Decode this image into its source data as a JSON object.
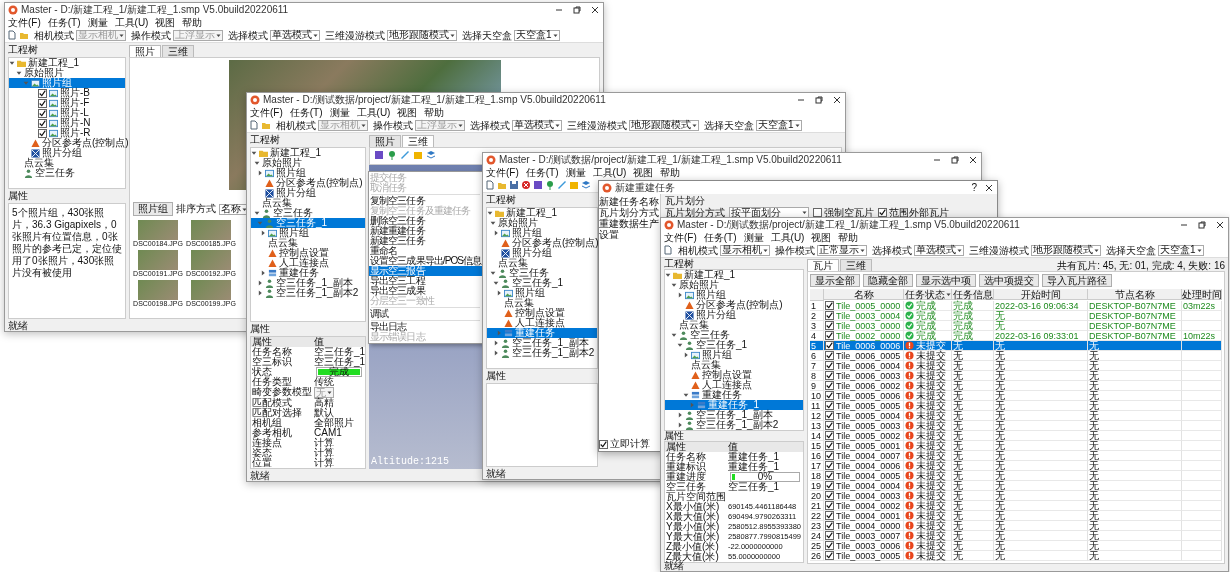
{
  "window_1": {
    "title": "Master - D:/新建工程_1/新建工程_1.smp V5.0build20220611",
    "menu": [
      "文件(F)",
      "任务(T)",
      "测量",
      "工具(U)",
      "视图",
      "帮助"
    ],
    "modes": [
      {
        "label": "相机模式",
        "value": "显示相机",
        "disabled": true
      },
      {
        "label": "操作模式",
        "value": "上浮显示",
        "disabled": true
      },
      {
        "label": "选择模式",
        "value": "单选模式",
        "disabled": false
      },
      {
        "label": "三维漫游模式",
        "value": "地形跟随模式",
        "disabled": false
      },
      {
        "label": "选择天空盒",
        "value": "天空盒1",
        "disabled": false
      }
    ],
    "tree_title": "工程树",
    "tree": [
      {
        "label": "新建工程_1",
        "kind": "folder",
        "selected": false,
        "expanded": true,
        "children": [
          {
            "label": "原始照片",
            "kind": "text",
            "selected": false,
            "expanded": true,
            "children": [
              {
                "label": "照片组",
                "kind": "image",
                "selected": true,
                "expanded": true,
                "children": [
                  {
                    "label": "照片-B",
                    "kind": "image",
                    "selected": false,
                    "checked": true
                  },
                  {
                    "label": "照片-F",
                    "kind": "image",
                    "selected": false,
                    "checked": true
                  },
                  {
                    "label": "照片-L",
                    "kind": "image",
                    "selected": false,
                    "checked": true
                  },
                  {
                    "label": "照片-N",
                    "kind": "image",
                    "selected": false,
                    "checked": true
                  },
                  {
                    "label": "照片-R",
                    "kind": "image",
                    "selected": false,
                    "checked": true
                  }
                ]
              },
              {
                "label": "分区参考点(控制点)",
                "kind": "triangle",
                "selected": false
              },
              {
                "label": "照片分组",
                "kind": "grid",
                "selected": false
              }
            ]
          },
          {
            "label": "点云集",
            "kind": "text",
            "selected": false
          },
          {
            "label": "空三任务",
            "kind": "person",
            "selected": false
          }
        ]
      }
    ],
    "props_title": "属性",
    "summary": "5个照片组，430张照片，36.3 Gigapixels，0张照片有位置信息，0张照片的参考已定，定位使用了0张照片，430张照片没有被使用",
    "tabs": [
      {
        "label": "照片",
        "selected": true
      },
      {
        "label": "三维",
        "selected": false
      }
    ],
    "group_button": "照片组",
    "sort_label": "排序方式",
    "sort_value": "名称",
    "thumbnails": [
      "DSC00184.JPG",
      "DSC00185.JPG",
      "DSC00191.JPG",
      "DSC00192.JPG",
      "DSC00198.JPG",
      "DSC00199.JPG"
    ],
    "status": "就绪"
  },
  "window_2": {
    "title": "Master - D:/测试数据/project/新建工程_1/新建工程_1.smp V5.0build20220611",
    "menu": [
      "文件(F)",
      "任务(T)",
      "测量",
      "工具(U)",
      "视图",
      "帮助"
    ],
    "modes": [
      {
        "label": "相机模式",
        "value": "显示相机",
        "disabled": true
      },
      {
        "label": "操作模式",
        "value": "上浮显示",
        "disabled": true
      },
      {
        "label": "选择模式",
        "value": "单选模式",
        "disabled": false
      },
      {
        "label": "三维漫游模式",
        "value": "地形跟随模式",
        "disabled": false
      },
      {
        "label": "选择天空盒",
        "value": "天空盒1",
        "disabled": false
      }
    ],
    "tree_title": "工程树",
    "tree": [
      {
        "label": "新建工程_1",
        "kind": "folder",
        "selected": false,
        "expanded": true,
        "children": [
          {
            "label": "原始照片",
            "kind": "text",
            "selected": false,
            "expanded": true,
            "children": [
              {
                "label": "照片组",
                "kind": "image",
                "selected": false,
                "expanded": false
              },
              {
                "label": "分区参考点(控制点)",
                "kind": "triangle",
                "selected": false
              },
              {
                "label": "照片分组",
                "kind": "grid",
                "selected": false
              }
            ]
          },
          {
            "label": "点云集",
            "kind": "text",
            "selected": false
          },
          {
            "label": "空三任务",
            "kind": "person",
            "selected": false,
            "expanded": true,
            "children": [
              {
                "label": "空三任务_1",
                "kind": "person",
                "selected": true,
                "expanded": true,
                "children": [
                  {
                    "label": "照片组",
                    "kind": "image",
                    "selected": false,
                    "expanded": false
                  },
                  {
                    "label": "点云集",
                    "kind": "text",
                    "selected": false
                  },
                  {
                    "label": "控制点设置",
                    "kind": "triangle",
                    "selected": false
                  },
                  {
                    "label": "人工连接点",
                    "kind": "triangle",
                    "selected": false
                  },
                  {
                    "label": "重建任务",
                    "kind": "stack",
                    "selected": false,
                    "expanded": false
                  }
                ]
              },
              {
                "label": "空三任务_1_副本",
                "kind": "person",
                "selected": false,
                "expanded": false
              },
              {
                "label": "空三任务_1_副本2",
                "kind": "person",
                "selected": false,
                "expanded": false
              }
            ]
          }
        ]
      }
    ],
    "context_menu": [
      {
        "kind": "item",
        "label": "提交任务",
        "disabled": true,
        "selected": false
      },
      {
        "kind": "item",
        "label": "取消任务",
        "disabled": true,
        "selected": false
      },
      {
        "kind": "separator"
      },
      {
        "kind": "item",
        "label": "复制空三任务",
        "disabled": false,
        "selected": false
      },
      {
        "kind": "item",
        "label": "复制空三任务及重建任务",
        "disabled": true,
        "selected": false
      },
      {
        "kind": "item",
        "label": "删除空三任务",
        "disabled": false,
        "selected": false
      },
      {
        "kind": "item",
        "label": "新建重建任务",
        "disabled": false,
        "selected": false
      },
      {
        "kind": "item",
        "label": "新建空三任务",
        "disabled": false,
        "selected": false
      },
      {
        "kind": "item",
        "label": "重命名",
        "disabled": false,
        "selected": false
      },
      {
        "kind": "item",
        "label": "设置空三成果导出/POS信息",
        "disabled": false,
        "selected": false
      },
      {
        "kind": "item",
        "label": "显示空三报告",
        "disabled": false,
        "selected": true
      },
      {
        "kind": "item",
        "label": "导出空三工程",
        "disabled": false,
        "selected": false
      },
      {
        "kind": "item",
        "label": "导出空三成果",
        "disabled": false,
        "selected": false
      },
      {
        "kind": "item",
        "label": "分层空三一致性",
        "disabled": true,
        "selected": false
      },
      {
        "kind": "separator"
      },
      {
        "kind": "item",
        "label": "调试",
        "disabled": false,
        "selected": false
      },
      {
        "kind": "separator"
      },
      {
        "kind": "item",
        "label": "导出日志",
        "disabled": false,
        "selected": false
      },
      {
        "kind": "item",
        "label": "显示错误日志",
        "disabled": true,
        "selected": false
      }
    ],
    "props_title": "属性",
    "props_header": [
      "属性",
      "值"
    ],
    "props": [
      {
        "kind": "text",
        "name": "任务名称",
        "value": "空三任务_1"
      },
      {
        "kind": "text",
        "name": "空三标识",
        "value": "空三任务_1"
      },
      {
        "kind": "progress",
        "name": "状态",
        "value": "完成",
        "level": 1
      },
      {
        "kind": "text",
        "name": "任务类型",
        "value": "传统"
      },
      {
        "kind": "dropdown",
        "name": "畸变参数模型",
        "value": "无"
      },
      {
        "kind": "text",
        "name": "匹配模式",
        "value": "高精"
      },
      {
        "kind": "text",
        "name": "匹配对选择",
        "value": "默认"
      },
      {
        "kind": "text",
        "name": "相机组",
        "value": "全部照片"
      },
      {
        "kind": "text",
        "name": "参考相机",
        "value": "CAM1"
      },
      {
        "kind": "text",
        "name": "连接点",
        "value": "计算"
      },
      {
        "kind": "text",
        "name": "姿态",
        "value": "计算"
      },
      {
        "kind": "text",
        "name": "位置",
        "value": "计算"
      }
    ],
    "tabs": [
      {
        "label": "照片",
        "selected": false
      },
      {
        "label": "三维",
        "selected": true
      }
    ],
    "altitude": "Altitude:1215",
    "status": "就绪"
  },
  "window_3": {
    "title": "Master - D:/测试数据/project/新建工程_1/新建工程_1.smp V5.0build20220611",
    "menu": [
      "文件(F)",
      "任务(T)",
      "测量",
      "工具(U)",
      "视图",
      "帮助"
    ],
    "tree_title": "工程树",
    "tree": [
      {
        "label": "新建工程_1",
        "kind": "folder",
        "selected": false,
        "expanded": true,
        "children": [
          {
            "label": "原始照片",
            "kind": "text",
            "selected": false,
            "expanded": true,
            "children": [
              {
                "label": "照片组",
                "kind": "image",
                "selected": false,
                "expanded": false
              },
              {
                "label": "分区参考点(控制点)",
                "kind": "triangle",
                "selected": false
              },
              {
                "label": "照片分组",
                "kind": "grid",
                "selected": false
              }
            ]
          },
          {
            "label": "点云集",
            "kind": "text",
            "selected": false
          },
          {
            "label": "空三任务",
            "kind": "person",
            "selected": false,
            "expanded": true,
            "children": [
              {
                "label": "空三任务_1",
                "kind": "person",
                "selected": false,
                "expanded": true,
                "children": [
                  {
                    "label": "照片组",
                    "kind": "image",
                    "selected": false,
                    "expanded": false
                  },
                  {
                    "label": "点云集",
                    "kind": "text",
                    "selected": false
                  },
                  {
                    "label": "控制点设置",
                    "kind": "triangle",
                    "selected": false
                  },
                  {
                    "label": "人工连接点",
                    "kind": "triangle",
                    "selected": false
                  },
                  {
                    "label": "重建任务",
                    "kind": "stack",
                    "selected": true,
                    "expanded": false
                  }
                ]
              },
              {
                "label": "空三任务_1_副本",
                "kind": "person",
                "selected": false,
                "expanded": false
              },
              {
                "label": "空三任务_1_副本2",
                "kind": "person",
                "selected": false,
                "expanded": false
              }
            ]
          }
        ]
      }
    ],
    "props_title": "属性",
    "status": "就绪"
  },
  "dialog": {
    "title": "新建重建任务",
    "help": "?",
    "nav": [
      {
        "label": "新建任务名称",
        "selected": false
      },
      {
        "label": "瓦片划分方式",
        "selected": false
      },
      {
        "label": "重建数据生产",
        "selected": false
      },
      {
        "label": "设置",
        "selected": false
      }
    ],
    "section": "瓦片划分",
    "field_label": "瓦片划分方式",
    "field_value": "按平面划分",
    "options": [
      {
        "label": "强制空瓦片",
        "checked": false
      },
      {
        "label": "范围外部瓦片",
        "checked": true
      }
    ],
    "submit_now": {
      "label": "立即计算",
      "checked": true
    }
  },
  "window_4": {
    "title": "Master - D:/测试数据/project/新建工程_1/新建工程_1.smp V5.0build20220611",
    "menu": [
      "文件(F)",
      "任务(T)",
      "测量",
      "工具(U)",
      "视图",
      "帮助"
    ],
    "modes": [
      {
        "label": "相机模式",
        "value": "显示相机",
        "disabled": false
      },
      {
        "label": "操作模式",
        "value": "正常显示",
        "disabled": false
      },
      {
        "label": "选择模式",
        "value": "单选模式",
        "disabled": false
      },
      {
        "label": "三维漫游模式",
        "value": "地形跟随模式",
        "disabled": false
      },
      {
        "label": "选择天空盒",
        "value": "天空盒1",
        "disabled": false
      }
    ],
    "tree_title": "工程树",
    "tree": [
      {
        "label": "新建工程_1",
        "kind": "folder",
        "selected": false,
        "expanded": true,
        "children": [
          {
            "label": "原始照片",
            "kind": "text",
            "selected": false,
            "expanded": true,
            "children": [
              {
                "label": "照片组",
                "kind": "image",
                "selected": false,
                "expanded": false
              },
              {
                "label": "分区参考点(控制点)",
                "kind": "triangle",
                "selected": false
              },
              {
                "label": "照片分组",
                "kind": "grid",
                "selected": false
              }
            ]
          },
          {
            "label": "点云集",
            "kind": "text",
            "selected": false
          },
          {
            "label": "空三任务",
            "kind": "person",
            "selected": false,
            "expanded": true,
            "children": [
              {
                "label": "空三任务_1",
                "kind": "person",
                "selected": false,
                "expanded": true,
                "children": [
                  {
                    "label": "照片组",
                    "kind": "image",
                    "selected": false,
                    "expanded": false
                  },
                  {
                    "label": "点云集",
                    "kind": "text",
                    "selected": false
                  },
                  {
                    "label": "控制点设置",
                    "kind": "triangle",
                    "selected": false
                  },
                  {
                    "label": "人工连接点",
                    "kind": "triangle",
                    "selected": false
                  },
                  {
                    "label": "重建任务",
                    "kind": "stack",
                    "selected": false,
                    "expanded": true,
                    "children": [
                      {
                        "label": "重建任务_1",
                        "kind": "stack",
                        "selected": true,
                        "expanded": false
                      }
                    ]
                  }
                ]
              },
              {
                "label": "空三任务_1_副本",
                "kind": "person",
                "selected": false,
                "expanded": false
              },
              {
                "label": "空三任务_1_副本2",
                "kind": "person",
                "selected": false,
                "expanded": false
              }
            ]
          }
        ]
      }
    ],
    "props_title": "属性",
    "props_header": [
      "属性",
      "值"
    ],
    "props": [
      {
        "kind": "text",
        "name": "任务名称",
        "value": "重建任务_1"
      },
      {
        "kind": "text",
        "name": "重建标识",
        "value": "重建任务_1"
      },
      {
        "kind": "progress",
        "name": "重建进度",
        "value": "0%",
        "level": 0.05
      },
      {
        "kind": "text",
        "name": "空三任务",
        "value": "空三任务_1"
      },
      {
        "kind": "text",
        "name": "瓦片空间范围"
      },
      {
        "kind": "text",
        "name": "X最小值(米)",
        "value": "690145.4461186448"
      },
      {
        "kind": "text",
        "name": "X最大值(米)",
        "value": "690494.9790263311"
      },
      {
        "kind": "text",
        "name": "Y最小值(米)",
        "value": "2580512.8955393380"
      },
      {
        "kind": "text",
        "name": "Y最大值(米)",
        "value": "2580877.7990815499"
      },
      {
        "kind": "text",
        "name": "Z最小值(米)",
        "value": "-22.0000000000"
      },
      {
        "kind": "text",
        "name": "Z最大值(米)",
        "value": "55.0000000000"
      }
    ],
    "tabs": [
      {
        "label": "瓦片",
        "selected": true
      },
      {
        "label": "三维",
        "selected": false
      }
    ],
    "summary": "共有瓦片: 45, 无: 01, 完成: 4, 失败: 16",
    "buttons": [
      "显示全部",
      "隐藏全部",
      "显示选中项",
      "选中项提交",
      "导入瓦片路径"
    ],
    "columns": [
      {
        "label": "名称",
        "sorted": false
      },
      {
        "label": "任务状态",
        "sorted": true
      },
      {
        "label": "任务信息",
        "sorted": false
      },
      {
        "label": "开始时间",
        "sorted": false
      },
      {
        "label": "节点名称",
        "sorted": false
      },
      {
        "label": "处理时间",
        "sorted": false
      }
    ],
    "rows": [
      {
        "index": "1",
        "checked": true,
        "name": "Tile_0005_0000",
        "kind": "done",
        "status": "完成",
        "info": "完成",
        "start": "2022-03-16 09:06:34",
        "node": "DESKTOP-B07N7ME",
        "duration": "03m22s",
        "selected": false
      },
      {
        "index": "2",
        "checked": true,
        "name": "Tile_0003_0004",
        "kind": "done",
        "status": "完成",
        "info": "完成",
        "start": "无",
        "node": "DESKTOP-B07N7ME",
        "selected": false
      },
      {
        "index": "3",
        "checked": true,
        "name": "Tile_0003_0000",
        "kind": "done",
        "status": "完成",
        "info": "完成",
        "start": "无",
        "node": "DESKTOP-B07N7ME",
        "selected": false
      },
      {
        "index": "4",
        "checked": true,
        "name": "Tile_0002_0000",
        "kind": "done",
        "status": "完成",
        "info": "完成",
        "start": "2022-03-16 09:33:01",
        "node": "DESKTOP-B07N7ME",
        "duration": "10m22s",
        "selected": false
      },
      {
        "index": "5",
        "checked": true,
        "name": "Tile_0006_0006",
        "kind": "pending",
        "status": "未提交",
        "info": "无",
        "start": "无",
        "node": "无",
        "selected": true
      },
      {
        "index": "6",
        "checked": true,
        "name": "Tile_0006_0005",
        "kind": "pending",
        "status": "未提交",
        "info": "无",
        "start": "无",
        "node": "无",
        "selected": false
      },
      {
        "index": "7",
        "checked": true,
        "name": "Tile_0006_0004",
        "kind": "pending",
        "status": "未提交",
        "info": "无",
        "start": "无",
        "node": "无",
        "selected": false
      },
      {
        "index": "8",
        "checked": true,
        "name": "Tile_0006_0003",
        "kind": "pending",
        "status": "未提交",
        "info": "无",
        "start": "无",
        "node": "无",
        "selected": false
      },
      {
        "index": "9",
        "checked": true,
        "name": "Tile_0006_0002",
        "kind": "pending",
        "status": "未提交",
        "info": "无",
        "start": "无",
        "node": "无",
        "selected": false
      },
      {
        "index": "10",
        "checked": true,
        "name": "Tile_0005_0006",
        "kind": "pending",
        "status": "未提交",
        "info": "无",
        "start": "无",
        "node": "无",
        "selected": false
      },
      {
        "index": "11",
        "checked": true,
        "name": "Tile_0005_0005",
        "kind": "pending",
        "status": "未提交",
        "info": "无",
        "start": "无",
        "node": "无",
        "selected": false
      },
      {
        "index": "12",
        "checked": true,
        "name": "Tile_0005_0004",
        "kind": "pending",
        "status": "未提交",
        "info": "无",
        "start": "无",
        "node": "无",
        "selected": false
      },
      {
        "index": "13",
        "checked": true,
        "name": "Tile_0005_0003",
        "kind": "pending",
        "status": "未提交",
        "info": "无",
        "start": "无",
        "node": "无",
        "selected": false
      },
      {
        "index": "14",
        "checked": true,
        "name": "Tile_0005_0002",
        "kind": "pending",
        "status": "未提交",
        "info": "无",
        "start": "无",
        "node": "无",
        "selected": false
      },
      {
        "index": "15",
        "checked": true,
        "name": "Tile_0005_0001",
        "kind": "pending",
        "status": "未提交",
        "info": "无",
        "start": "无",
        "node": "无",
        "selected": false
      },
      {
        "index": "16",
        "checked": true,
        "name": "Tile_0004_0007",
        "kind": "pending",
        "status": "未提交",
        "info": "无",
        "start": "无",
        "node": "无",
        "selected": false
      },
      {
        "index": "17",
        "checked": true,
        "name": "Tile_0004_0006",
        "kind": "pending",
        "status": "未提交",
        "info": "无",
        "start": "无",
        "node": "无",
        "selected": false
      },
      {
        "index": "18",
        "checked": true,
        "name": "Tile_0004_0005",
        "kind": "pending",
        "status": "未提交",
        "info": "无",
        "start": "无",
        "node": "无",
        "selected": false
      },
      {
        "index": "19",
        "checked": true,
        "name": "Tile_0004_0004",
        "kind": "pending",
        "status": "未提交",
        "info": "无",
        "start": "无",
        "node": "无",
        "selected": false
      },
      {
        "index": "20",
        "checked": true,
        "name": "Tile_0004_0003",
        "kind": "pending",
        "status": "未提交",
        "info": "无",
        "start": "无",
        "node": "无",
        "selected": false
      },
      {
        "index": "21",
        "checked": true,
        "name": "Tile_0004_0002",
        "kind": "pending",
        "status": "未提交",
        "info": "无",
        "start": "无",
        "node": "无",
        "selected": false
      },
      {
        "index": "22",
        "checked": true,
        "name": "Tile_0004_0001",
        "kind": "pending",
        "status": "未提交",
        "info": "无",
        "start": "无",
        "node": "无",
        "selected": false
      },
      {
        "index": "23",
        "checked": true,
        "name": "Tile_0004_0000",
        "kind": "pending",
        "status": "未提交",
        "info": "无",
        "start": "无",
        "node": "无",
        "selected": false
      },
      {
        "index": "24",
        "checked": true,
        "name": "Tile_0003_0007",
        "kind": "pending",
        "status": "未提交",
        "info": "无",
        "start": "无",
        "node": "无",
        "selected": false
      },
      {
        "index": "25",
        "checked": true,
        "name": "Tile_0003_0006",
        "kind": "pending",
        "status": "未提交",
        "info": "无",
        "start": "无",
        "node": "无",
        "selected": false
      },
      {
        "index": "26",
        "checked": true,
        "name": "Tile_0003_0005",
        "kind": "pending",
        "status": "未提交",
        "info": "无",
        "start": "无",
        "node": "无",
        "selected": false
      }
    ],
    "status": "就绪"
  }
}
